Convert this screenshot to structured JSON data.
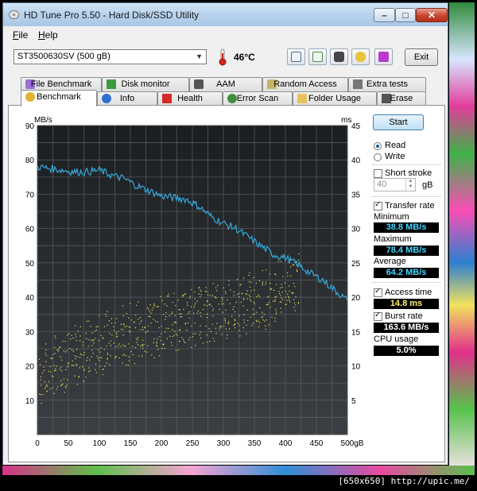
{
  "window": {
    "title": "HD Tune Pro 5.50 - Hard Disk/SSD Utility"
  },
  "menu": [
    "File",
    "Help"
  ],
  "toolbar": {
    "drive": "ST3500630SV (500 gB)",
    "temperature": "46°C",
    "exit_label": "Exit"
  },
  "tabs_top": [
    "File Benchmark",
    "Disk monitor",
    "AAM",
    "Random Access",
    "Extra tests"
  ],
  "tabs_bottom": [
    "Benchmark",
    "Info",
    "Health",
    "Error Scan",
    "Folder Usage",
    "Erase"
  ],
  "active_tab": "Benchmark",
  "side": {
    "start_label": "Start",
    "read_label": "Read",
    "write_label": "Write",
    "short_stroke_label": "Short stroke",
    "stroke_value": "40",
    "stroke_unit": "gB",
    "transfer_rate_label": "Transfer rate",
    "minimum_label": "Minimum",
    "minimum_value": "38.8 MB/s",
    "maximum_label": "Maximum",
    "maximum_value": "78.4 MB/s",
    "average_label": "Average",
    "average_value": "64.2 MB/s",
    "access_time_label": "Access time",
    "access_time_value": "14.8 ms",
    "burst_rate_label": "Burst rate",
    "burst_rate_value": "163.6 MB/s",
    "cpu_usage_label": "CPU usage",
    "cpu_usage_value": "5.0%"
  },
  "chart_data": {
    "type": "line",
    "title": "",
    "xlabel": "gB",
    "ylabel": "MB/s",
    "y2label": "ms",
    "xlim": [
      0,
      500
    ],
    "ylim": [
      0,
      90
    ],
    "y2lim": [
      0,
      45
    ],
    "grid": true,
    "x_ticks": [
      "0",
      "50",
      "100",
      "150",
      "200",
      "250",
      "300",
      "350",
      "400",
      "450",
      "500gB"
    ],
    "y_ticks": [
      "10",
      "20",
      "30",
      "40",
      "50",
      "60",
      "70",
      "80",
      "90"
    ],
    "y2_ticks": [
      "5",
      "10",
      "15",
      "20",
      "25",
      "30",
      "35",
      "40",
      "45"
    ],
    "series": [
      {
        "color": "#35a9dd",
        "x": [
          0,
          20,
          40,
          60,
          80,
          100,
          120,
          140,
          160,
          180,
          200,
          220,
          240,
          260,
          280,
          300,
          320,
          340,
          360,
          380,
          400,
          420,
          440,
          460,
          480,
          500
        ],
        "y": [
          78,
          77.5,
          77,
          76.5,
          76.5,
          77,
          75.5,
          74.5,
          72.5,
          71,
          69.5,
          69,
          68.5,
          66.5,
          63.5,
          61.5,
          60,
          57.5,
          55,
          52.5,
          51.5,
          49.5,
          47,
          45,
          42,
          39
        ]
      }
    ],
    "scatter": {
      "name": "Access time",
      "color": "#e6e85a",
      "axis": "right",
      "points": [
        [
          5,
          8
        ],
        [
          10,
          9.5
        ],
        [
          15,
          8.5
        ],
        [
          20,
          10
        ],
        [
          25,
          9
        ],
        [
          30,
          10.5
        ],
        [
          35,
          9.8
        ],
        [
          40,
          11
        ],
        [
          45,
          10.2
        ],
        [
          50,
          11.5
        ],
        [
          55,
          10.8
        ],
        [
          60,
          12
        ],
        [
          65,
          11.2
        ],
        [
          70,
          12.5
        ],
        [
          75,
          11.6
        ],
        [
          80,
          13
        ],
        [
          85,
          12.1
        ],
        [
          90,
          13.2
        ],
        [
          95,
          12.4
        ],
        [
          100,
          13.6
        ],
        [
          105,
          12.8
        ],
        [
          110,
          14
        ],
        [
          115,
          13.1
        ],
        [
          120,
          14.4
        ],
        [
          125,
          13.4
        ],
        [
          130,
          14.7
        ],
        [
          135,
          13.8
        ],
        [
          140,
          15
        ],
        [
          145,
          14.1
        ],
        [
          150,
          15.2
        ],
        [
          155,
          14.3
        ],
        [
          160,
          15.5
        ],
        [
          165,
          14.6
        ],
        [
          170,
          15.8
        ],
        [
          175,
          14.9
        ],
        [
          180,
          16
        ],
        [
          185,
          15.2
        ],
        [
          190,
          16.3
        ],
        [
          195,
          15.5
        ],
        [
          200,
          16.6
        ],
        [
          205,
          15.7
        ],
        [
          210,
          16.8
        ],
        [
          215,
          16
        ],
        [
          220,
          17.1
        ],
        [
          225,
          16.2
        ],
        [
          230,
          17.3
        ],
        [
          235,
          16.5
        ],
        [
          240,
          17.5
        ],
        [
          245,
          16.7
        ],
        [
          250,
          17.8
        ],
        [
          255,
          16.9
        ],
        [
          260,
          18
        ],
        [
          265,
          17.2
        ],
        [
          270,
          18.2
        ],
        [
          275,
          17.4
        ],
        [
          280,
          18.4
        ],
        [
          285,
          17.6
        ],
        [
          290,
          18.6
        ],
        [
          295,
          17.8
        ],
        [
          300,
          18.8
        ],
        [
          305,
          18
        ],
        [
          310,
          19
        ],
        [
          315,
          18.2
        ],
        [
          320,
          19.2
        ],
        [
          325,
          18.4
        ],
        [
          330,
          19.5
        ],
        [
          335,
          18.6
        ],
        [
          340,
          19.8
        ],
        [
          345,
          18.9
        ],
        [
          350,
          20
        ],
        [
          355,
          19.1
        ],
        [
          360,
          20.3
        ],
        [
          365,
          19.4
        ],
        [
          370,
          20.6
        ],
        [
          375,
          19.8
        ],
        [
          380,
          21
        ],
        [
          385,
          20.1
        ],
        [
          390,
          21.4
        ],
        [
          395,
          20.6
        ],
        [
          400,
          22
        ],
        [
          405,
          21
        ],
        [
          410,
          22.5
        ],
        [
          415,
          21.4
        ],
        [
          420,
          23
        ]
      ]
    }
  }
}
